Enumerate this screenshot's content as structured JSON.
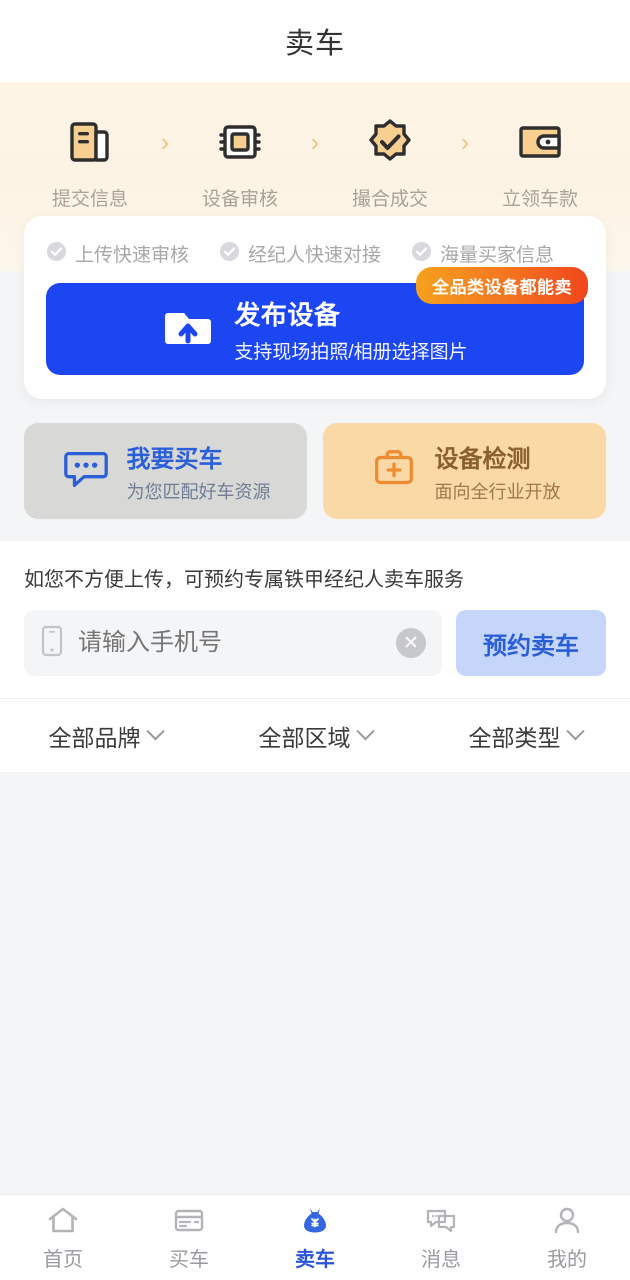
{
  "header": {
    "title": "卖车"
  },
  "steps": {
    "separator": "›",
    "items": [
      {
        "label": "提交信息",
        "icon": "document-upload-icon"
      },
      {
        "label": "设备审核",
        "icon": "chip-review-icon"
      },
      {
        "label": "撮合成交",
        "icon": "badge-check-icon"
      },
      {
        "label": "立领车款",
        "icon": "wallet-icon"
      }
    ]
  },
  "publish": {
    "features": [
      {
        "label": "上传快速审核",
        "icon": "check-circle-icon"
      },
      {
        "label": "经纪人快速对接",
        "icon": "check-circle-icon"
      },
      {
        "label": "海量买家信息",
        "icon": "check-circle-icon"
      }
    ],
    "badge": "全品类设备都能卖",
    "title": "发布设备",
    "subtitle": "支持现场拍照/相册选择图片",
    "icon": "folder-upload-icon",
    "button_color": "#1c46f2"
  },
  "dual_cards": [
    {
      "title": "我要买车",
      "subtitle": "为您匹配好车资源",
      "icon": "chat-bubble-icon",
      "bg": "#d8d8d6",
      "accent": "#2a5fd8"
    },
    {
      "title": "设备检测",
      "subtitle": "面向全行业开放",
      "icon": "toolbox-plus-icon",
      "bg": "#fbd9a6",
      "accent": "#ef8b30"
    }
  ],
  "broker": {
    "note": "如您不方便上传，可预约专属铁甲经纪人卖车服务",
    "phone_icon": "mobile-phone-icon",
    "phone_value": "",
    "phone_placeholder": "请输入手机号",
    "clear_icon": "clear-circle-icon",
    "clear_glyph": "✕",
    "button_label": "预约卖车",
    "button_color": "#2a5fd8"
  },
  "filters": [
    {
      "label": "全部品牌",
      "icon": "chevron-down-icon"
    },
    {
      "label": "全部区域",
      "icon": "chevron-down-icon"
    },
    {
      "label": "全部类型",
      "icon": "chevron-down-icon"
    }
  ],
  "tabbar": {
    "active_color": "#2a56d6",
    "items": [
      {
        "label": "首页",
        "icon": "home-icon",
        "active": false
      },
      {
        "label": "买车",
        "icon": "card-icon",
        "active": false
      },
      {
        "label": "卖车",
        "icon": "money-bag-icon",
        "active": true
      },
      {
        "label": "消息",
        "icon": "message-icon",
        "active": false
      },
      {
        "label": "我的",
        "icon": "person-icon",
        "active": false
      }
    ]
  }
}
